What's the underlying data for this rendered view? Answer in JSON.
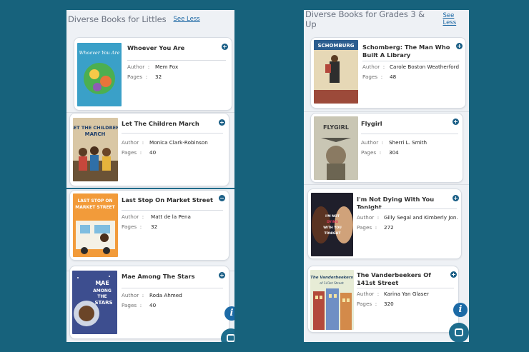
{
  "left_panel": {
    "title": "Diverse Books for Littles",
    "see_less": "See Less",
    "books": [
      {
        "title": "Whoever You Are",
        "author_label": "Author",
        "author": "Mem Fox",
        "pages_label": "Pages",
        "pages": "32",
        "cover_text": "WHOEVER YOU ARE"
      },
      {
        "title": "Let The Children March",
        "author_label": "Author",
        "author": "Monica Clark-Robinson",
        "pages_label": "Pages",
        "pages": "40",
        "cover_text": "LET THE CHILDREN MARCH"
      },
      {
        "title": "Last Stop On Market Street",
        "author_label": "Author",
        "author": "Matt de la Pena",
        "pages_label": "Pages",
        "pages": "32",
        "cover_text": "LAST STOP ON MARKET STREET"
      },
      {
        "title": "Mae Among The Stars",
        "author_label": "Author",
        "author": "Roda Ahmed",
        "pages_label": "Pages",
        "pages": "40",
        "cover_text": "MAE AMONG THE STARS"
      }
    ]
  },
  "right_panel": {
    "title": "Diverse Books for Grades 3 & Up",
    "see_less": "See Less",
    "books": [
      {
        "title": "Schomberg: The Man Who Built A Library",
        "author_label": "Author",
        "author": "Carole Boston Weatherford",
        "pages_label": "Pages",
        "pages": "48",
        "cover_text": "SCHOMBURG"
      },
      {
        "title": "Flygirl",
        "author_label": "Author",
        "author": "Sherri L. Smith",
        "pages_label": "Pages",
        "pages": "304",
        "cover_text": "FLYGIRL"
      },
      {
        "title": "I'm Not Dying With You Tonight",
        "author_label": "Author",
        "author": "Gilly Segal and Kimberly Jon...",
        "pages_label": "Pages",
        "pages": "272",
        "cover_text": "I'M NOT DYING WITH YOU TONIGHT"
      },
      {
        "title": "The Vanderbeekers Of 141st Street",
        "author_label": "Author",
        "author": "Karina Yan Glaser",
        "pages_label": "Pages",
        "pages": "320",
        "cover_text": "THE VANDERBEEKERS OF 141ST STREET"
      }
    ]
  },
  "icons": {
    "add": "plus-icon",
    "collapse": "minus-icon",
    "info": "info-icon",
    "chat": "chat-icon"
  },
  "glyphs": {
    "plus": "+",
    "minus": "−",
    "info": "i"
  },
  "colors": {
    "background": "#17627c",
    "accent": "#1b5f86",
    "panel": "#eef1f5"
  }
}
